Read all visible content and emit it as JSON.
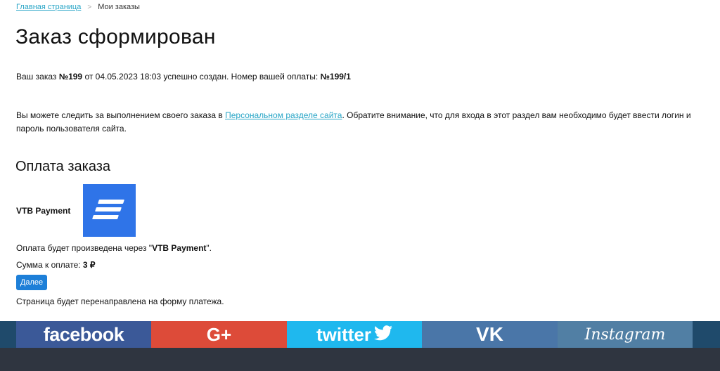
{
  "breadcrumb": {
    "home": "Главная страница",
    "separator": ">",
    "current": "Мои заказы"
  },
  "page_title": "Заказ сформирован",
  "order": {
    "prefix": "Ваш заказ ",
    "number": "№199",
    "middle": " от 04.05.2023 18:03 успешно создан. Номер вашей оплаты: ",
    "payment_number": "№199/1"
  },
  "info": {
    "before_link": "Вы можете следить за выполнением своего заказа в ",
    "link": "Персональном разделе сайта",
    "after_link": ". Обратите внимание, что для входа в этот раздел вам необходимо будет ввести логин и пароль пользователя сайта."
  },
  "payment_section": {
    "title": "Оплата заказа",
    "system_name": "VTB Payment",
    "note_before": "Оплата будет произведена через \"",
    "note_system": "VTB Payment",
    "note_after": "\".",
    "sum_label": "Сумма к оплате: ",
    "sum_value": "3 ₽",
    "button_label": "Далее",
    "redirect_note": "Страница будет перенаправлена на форму платежа."
  },
  "social": {
    "facebook": "facebook",
    "googleplus": "G+",
    "twitter": "twitter",
    "vk": "VK",
    "instagram": "Instagram"
  },
  "colors": {
    "link": "#2aa6c7",
    "button": "#1d7fd8",
    "vtb_logo": "#2f74e8",
    "facebook": "#3b5998",
    "googleplus": "#dd4b39",
    "twitter": "#1fb8ee",
    "vk": "#4a76a8",
    "instagram": "#517fa4",
    "footer": "#2f3540"
  },
  "icons": [
    "vtb-logo-icon",
    "twitter-bird-icon"
  ]
}
